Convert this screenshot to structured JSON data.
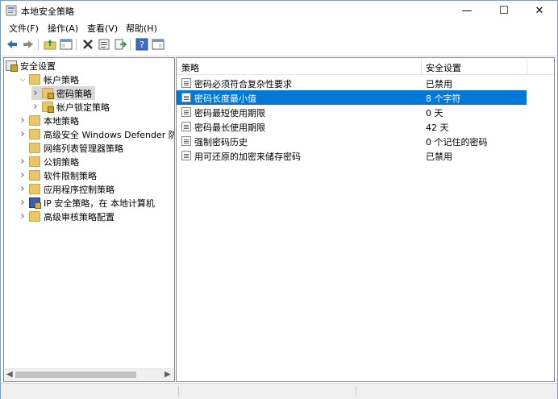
{
  "window": {
    "title": "本地安全策略"
  },
  "title_controls": {
    "minimize": "—",
    "maximize": "☐",
    "close": "✕"
  },
  "menu": [
    "文件(F)",
    "操作(A)",
    "查看(V)",
    "帮助(H)"
  ],
  "toolbar": {
    "back": "back-icon",
    "forward": "forward-icon",
    "up": "up-folder-icon",
    "show_tree": "show-tree-icon",
    "delete": "delete-icon",
    "properties": "properties-icon",
    "export": "export-icon",
    "help": "help-icon",
    "view": "view-icon"
  },
  "tree": [
    {
      "label": "安全设置",
      "level": 0,
      "expanded": "open",
      "icon": "security-settings-icon"
    },
    {
      "label": "帐户策略",
      "level": 1,
      "expanded": "open",
      "icon": "folder-icon"
    },
    {
      "label": "密码策略",
      "level": 2,
      "expanded": "closed",
      "icon": "folder-lock-icon",
      "selected": true
    },
    {
      "label": "帐户锁定策略",
      "level": 2,
      "expanded": "closed",
      "icon": "folder-lock-icon"
    },
    {
      "label": "本地策略",
      "level": 1,
      "expanded": "closed",
      "icon": "folder-icon"
    },
    {
      "label": "高级安全 Windows Defender 防火墙",
      "level": 1,
      "expanded": "closed",
      "icon": "folder-icon"
    },
    {
      "label": "网络列表管理器策略",
      "level": 1,
      "expanded": "none",
      "icon": "folder-icon"
    },
    {
      "label": "公钥策略",
      "level": 1,
      "expanded": "closed",
      "icon": "folder-icon"
    },
    {
      "label": "软件限制策略",
      "level": 1,
      "expanded": "closed",
      "icon": "folder-icon"
    },
    {
      "label": "应用程序控制策略",
      "level": 1,
      "expanded": "closed",
      "icon": "folder-icon"
    },
    {
      "label": "IP 安全策略，在 本地计算机",
      "level": 1,
      "expanded": "closed",
      "icon": "ip-security-icon"
    },
    {
      "label": "高级审核策略配置",
      "level": 1,
      "expanded": "closed",
      "icon": "folder-icon"
    }
  ],
  "list": {
    "columns": [
      "策略",
      "安全设置"
    ],
    "rows": [
      {
        "policy": "密码必须符合复杂性要求",
        "setting": "已禁用"
      },
      {
        "policy": "密码长度最小值",
        "setting": "8 个字符",
        "selected": true
      },
      {
        "policy": "密码最短使用期限",
        "setting": "0 天"
      },
      {
        "policy": "密码最长使用期限",
        "setting": "42 天"
      },
      {
        "policy": "强制密码历史",
        "setting": "0 个记住的密码"
      },
      {
        "policy": "用可还原的加密来储存密码",
        "setting": "已禁用"
      }
    ]
  },
  "colors": {
    "selection": "#0078d7",
    "tree_selection": "#d9d9d9",
    "folder": "#e8c66a"
  }
}
